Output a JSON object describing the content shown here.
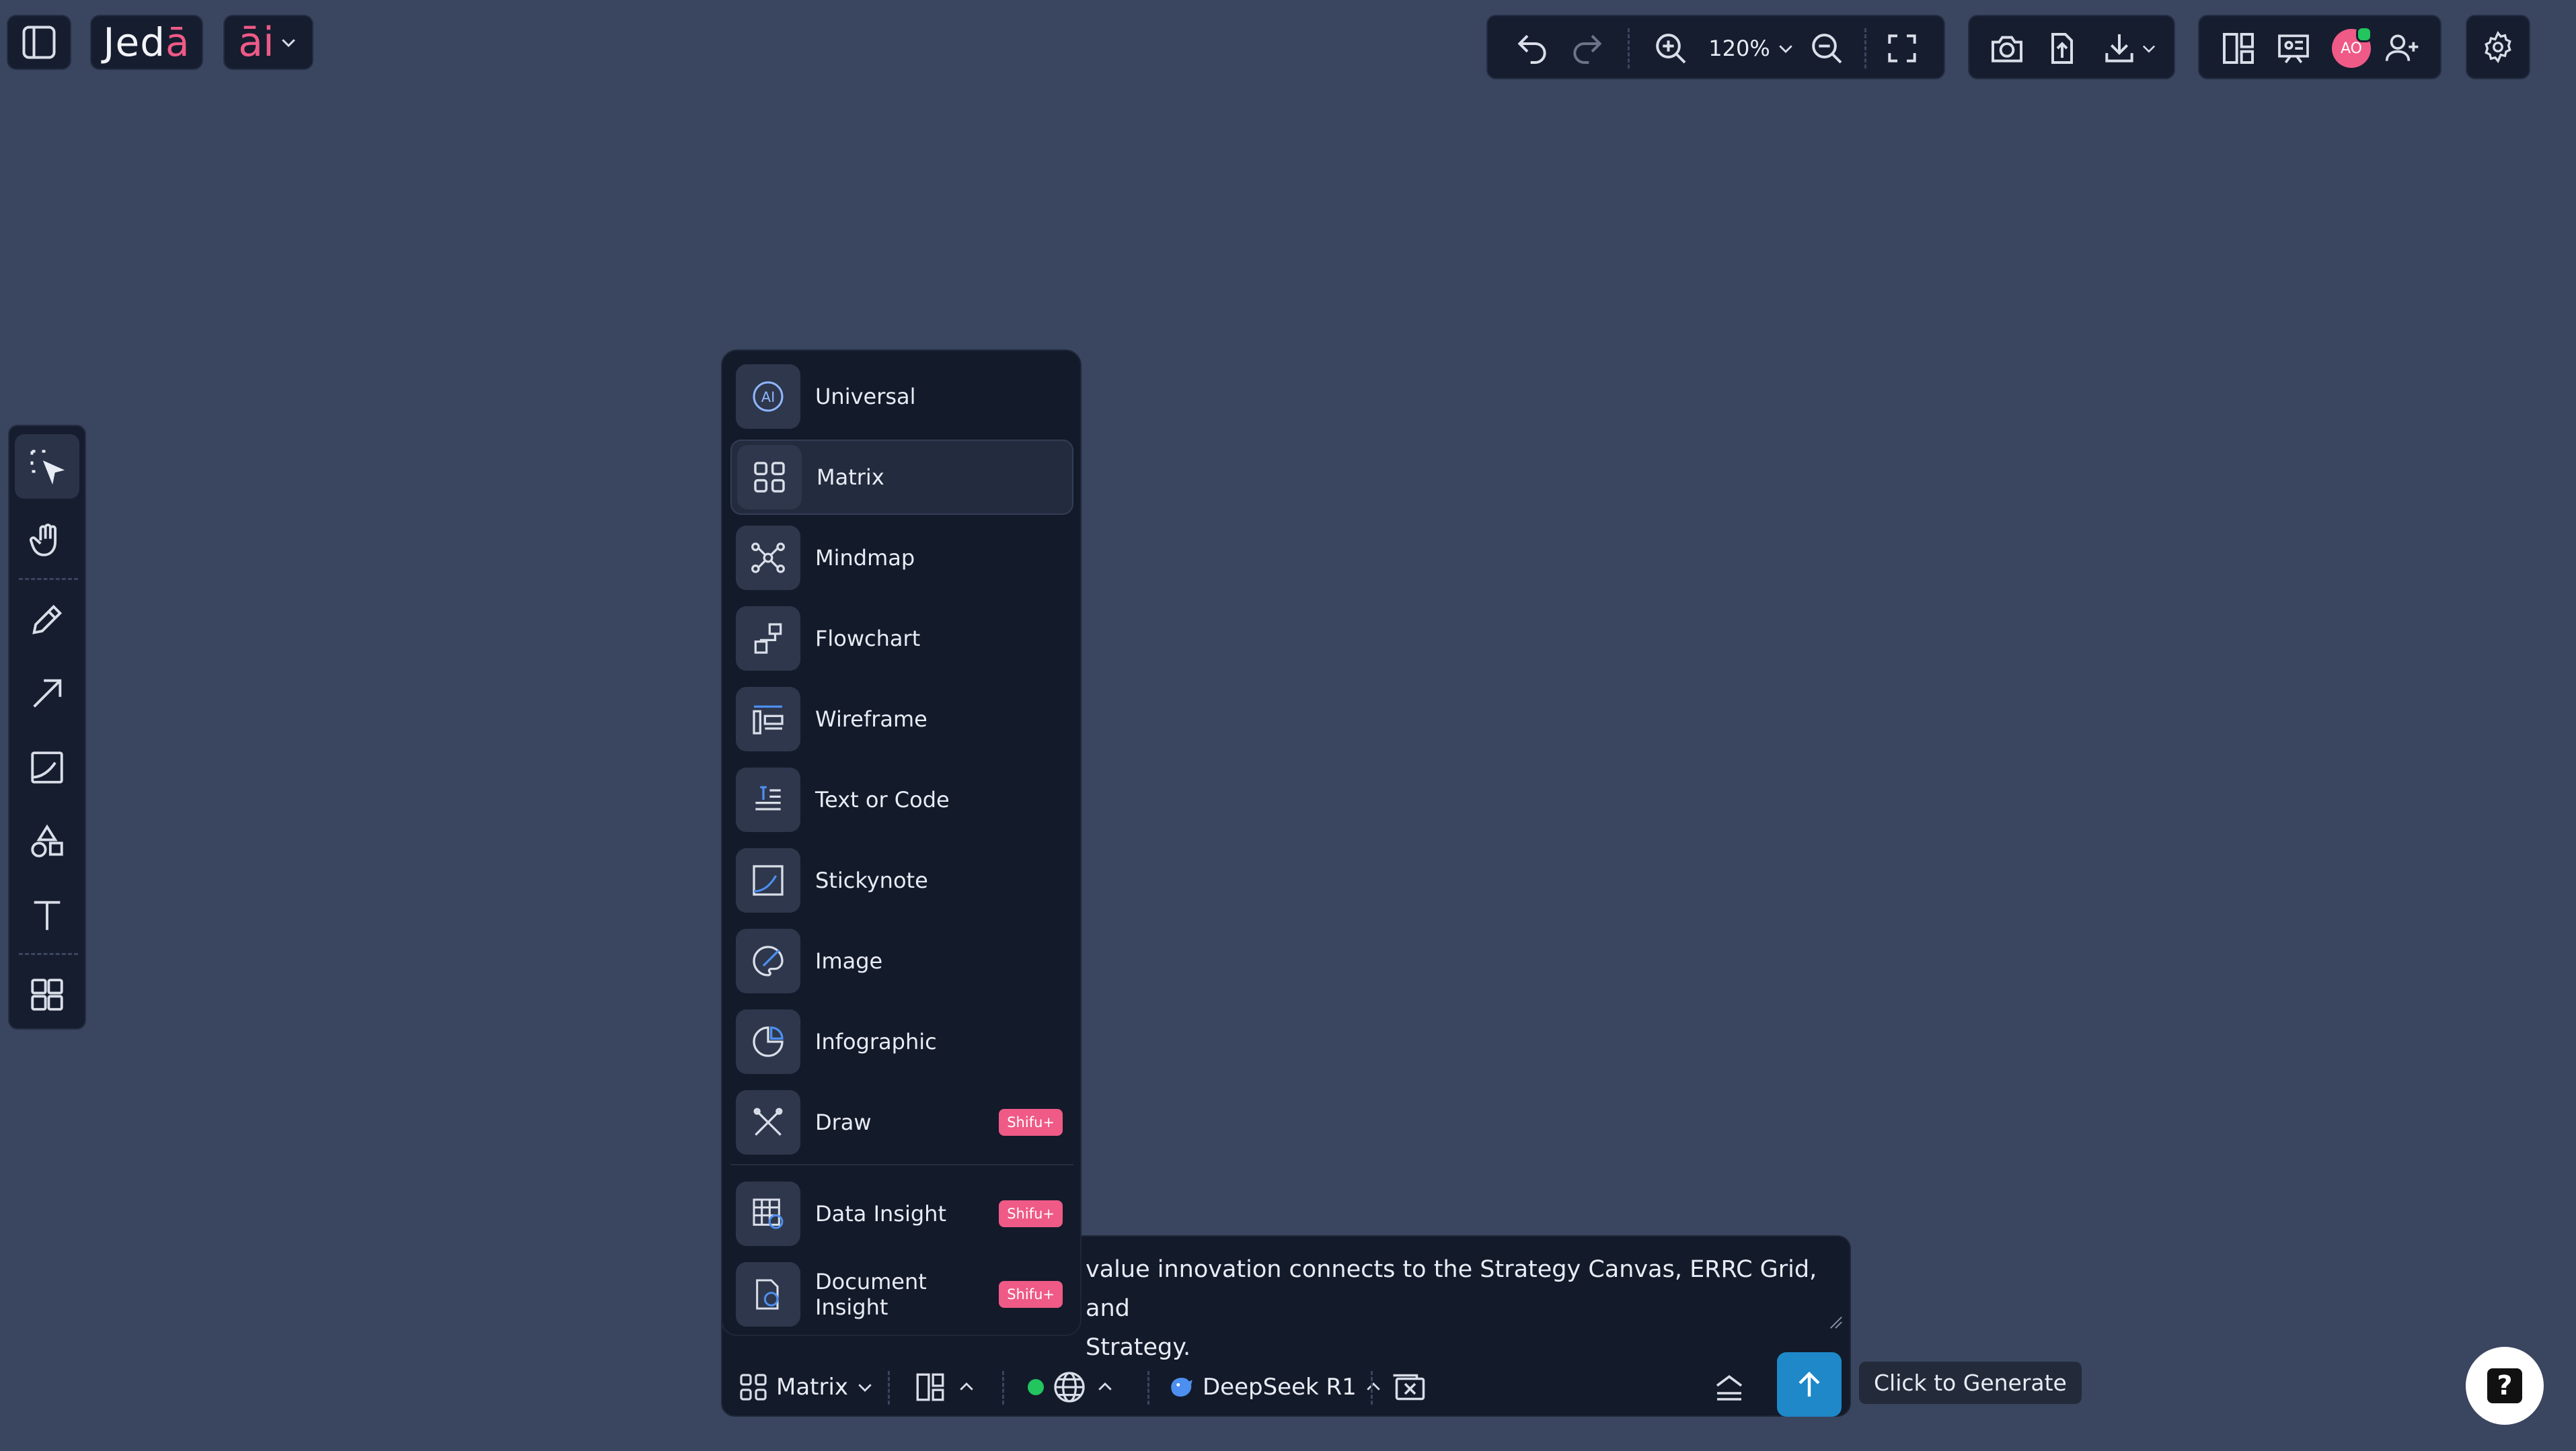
{
  "app": {
    "logo_text": "Jed",
    "logo_accent": "ā",
    "ai_label": "āi"
  },
  "toolbar": {
    "zoom_label": "120%"
  },
  "user": {
    "avatar_initials": "AO"
  },
  "type_menu": {
    "items": [
      {
        "label": "Universal",
        "icon": "ai-icon"
      },
      {
        "label": "Matrix",
        "icon": "matrix-icon",
        "selected": true
      },
      {
        "label": "Mindmap",
        "icon": "mindmap-icon"
      },
      {
        "label": "Flowchart",
        "icon": "flowchart-icon"
      },
      {
        "label": "Wireframe",
        "icon": "wireframe-icon"
      },
      {
        "label": "Text or Code",
        "icon": "text-code-icon"
      },
      {
        "label": "Stickynote",
        "icon": "stickynote-icon"
      },
      {
        "label": "Image",
        "icon": "image-icon"
      },
      {
        "label": "Infographic",
        "icon": "infographic-icon"
      },
      {
        "label": "Draw",
        "icon": "draw-icon",
        "badge": "Shifu+"
      },
      {
        "label": "Data Insight",
        "icon": "data-insight-icon",
        "badge": "Shifu+"
      },
      {
        "label": "Document Insight",
        "icon": "document-insight-icon",
        "badge": "Shifu+"
      }
    ]
  },
  "prompt": {
    "line1": "value innovation connects to the Strategy Canvas, ERRC Grid, and",
    "line2": "Strategy.",
    "type_label": "Matrix",
    "model_label": "DeepSeek R1",
    "generate_tooltip": "Click to Generate",
    "status_color": "#22c55e"
  },
  "help": {
    "label": "?"
  },
  "colors": {
    "background": "#3a4560",
    "panel": "#161d2f",
    "accent": "#ef5a86",
    "primary": "#1e88c8"
  }
}
